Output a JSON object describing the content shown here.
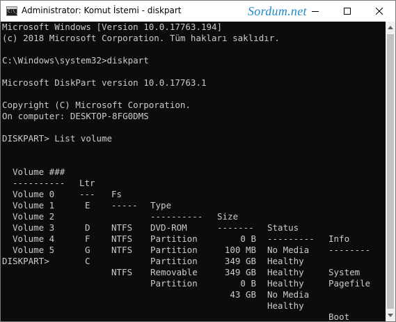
{
  "window": {
    "title": "Administrator: Komut İstemi - diskpart",
    "watermark": "Sordum.net",
    "icon_text": "C:\\_",
    "icons": [
      "cmd-app-icon",
      "minimize-icon",
      "maximize-icon",
      "close-icon",
      "scroll-up-icon",
      "scroll-down-icon"
    ]
  },
  "console": {
    "header_lines": [
      "Microsoft Windows [Version 10.0.17763.194]",
      "(c) 2018 Microsoft Corporation. Tüm hakları saklıdır.",
      "",
      "C:\\Windows\\system32>diskpart",
      "",
      "Microsoft DiskPart version 10.0.17763.1",
      "",
      "Copyright (C) Microsoft Corporation.",
      "On computer: DESKTOP-8FG0DMS",
      "",
      "DISKPART> List volume",
      ""
    ],
    "columns": [
      "Volume ###",
      "Ltr",
      "Fs",
      "Type",
      "Size",
      "Status",
      "Info"
    ],
    "separators": [
      "----------",
      "---",
      "-----",
      "----------",
      "-------",
      "---------",
      "--------"
    ],
    "volumes": [
      {
        "volume": "Volume 0",
        "ltr": "E",
        "fs": "",
        "type": "DVD-ROM",
        "size": "0 B",
        "status": "No Media",
        "info": ""
      },
      {
        "volume": "Volume 1",
        "ltr": "",
        "fs": "NTFS",
        "type": "Partition",
        "size": "100 MB",
        "status": "Healthy",
        "info": "System"
      },
      {
        "volume": "Volume 2",
        "ltr": "D",
        "fs": "NTFS",
        "type": "Partition",
        "size": "349 GB",
        "status": "Healthy",
        "info": "Pagefile"
      },
      {
        "volume": "Volume 3",
        "ltr": "F",
        "fs": "NTFS",
        "type": "Partition",
        "size": "349 GB",
        "status": "Healthy",
        "info": ""
      },
      {
        "volume": "Volume 4",
        "ltr": "G",
        "fs": "",
        "type": "Removable",
        "size": "0 B",
        "status": "No Media",
        "info": ""
      },
      {
        "volume": "Volume 5",
        "ltr": "C",
        "fs": "NTFS",
        "type": "Partition",
        "size": "43 GB",
        "status": "Healthy",
        "info": "Boot"
      }
    ],
    "prompt": "DISKPART>"
  },
  "colors": {
    "console_background": "#0c0c0c",
    "console_text": "#cccccc",
    "titlebar_background": "#ffffff",
    "watermark": "#1e8ac9",
    "scrollbar_track": "#f0f0f0",
    "scrollbar_thumb": "#c2c2c2"
  }
}
